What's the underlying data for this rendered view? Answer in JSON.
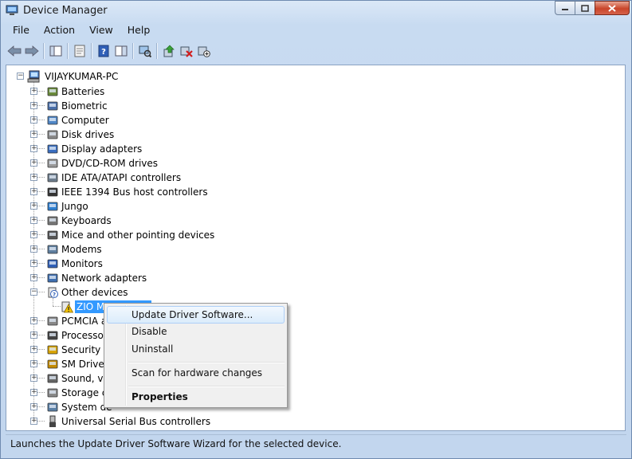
{
  "window": {
    "title": "Device Manager"
  },
  "menu": [
    "File",
    "Action",
    "View",
    "Help"
  ],
  "toolbar": {
    "buttons": [
      "back-arrow-icon",
      "forward-arrow-icon",
      "show-hide-tree-icon",
      "properties-sheet-icon",
      "help-icon",
      "action-pane-icon",
      "scan-hardware-icon",
      "update-driver-icon",
      "uninstall-icon",
      "disable-device-icon"
    ]
  },
  "tree": {
    "root": "VIJAYKUMAR-PC",
    "categories": [
      {
        "label": "Batteries",
        "icon": "battery-icon"
      },
      {
        "label": "Biometric",
        "icon": "biometric-icon"
      },
      {
        "label": "Computer",
        "icon": "computer-icon"
      },
      {
        "label": "Disk drives",
        "icon": "disk-drive-icon"
      },
      {
        "label": "Display adapters",
        "icon": "display-adapter-icon"
      },
      {
        "label": "DVD/CD-ROM drives",
        "icon": "dvd-drive-icon"
      },
      {
        "label": "IDE ATA/ATAPI controllers",
        "icon": "ide-controller-icon"
      },
      {
        "label": "IEEE 1394 Bus host controllers",
        "icon": "ieee1394-icon"
      },
      {
        "label": "Jungo",
        "icon": "jungo-icon"
      },
      {
        "label": "Keyboards",
        "icon": "keyboard-icon"
      },
      {
        "label": "Mice and other pointing devices",
        "icon": "mouse-icon"
      },
      {
        "label": "Modems",
        "icon": "modem-icon"
      },
      {
        "label": "Monitors",
        "icon": "monitor-icon"
      },
      {
        "label": "Network adapters",
        "icon": "network-adapter-icon"
      },
      {
        "label": "Other devices",
        "icon": "unknown-device-icon",
        "expanded": true
      },
      {
        "label": "PCMCIA a",
        "icon": "pcmcia-icon"
      },
      {
        "label": "Processors",
        "icon": "processor-icon"
      },
      {
        "label": "Security D",
        "icon": "security-device-icon"
      },
      {
        "label": "SM Driver",
        "icon": "sm-driver-icon"
      },
      {
        "label": "Sound, vic",
        "icon": "sound-icon"
      },
      {
        "label": "Storage co",
        "icon": "storage-controller-icon"
      },
      {
        "label": "System de",
        "icon": "system-device-icon"
      },
      {
        "label": "Universal Serial Bus controllers",
        "icon": "usb-icon"
      }
    ],
    "child": {
      "label": "ZIO Mo",
      "icon": "warning-device-icon"
    }
  },
  "context_menu": {
    "items": [
      {
        "label": "Update Driver Software...",
        "highlighted": true
      },
      {
        "label": "Disable"
      },
      {
        "label": "Uninstall"
      },
      {
        "label": "Scan for hardware changes"
      },
      {
        "label": "Properties",
        "bold": true
      }
    ]
  },
  "status": "Launches the Update Driver Software Wizard for the selected device."
}
